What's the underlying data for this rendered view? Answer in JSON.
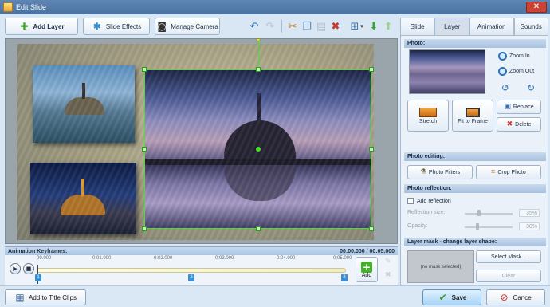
{
  "window": {
    "title": "Edit Slide",
    "close_glyph": "✕"
  },
  "toolbar": {
    "add_layer": "Add Layer",
    "slide_effects": "Slide Effects",
    "manage_camera": "Manage Camera",
    "icons": [
      "undo-icon",
      "redo-icon",
      "cut-icon",
      "copy-icon",
      "paste-icon",
      "delete-icon",
      "align-icon",
      "move-down-icon",
      "move-up-icon"
    ]
  },
  "keyframes": {
    "header": "Animation Keyframes:",
    "time": "00:00.000 / 00:05.000",
    "ticks": [
      "00.000",
      "0:01.000",
      "0:02.000",
      "0:03.000",
      "0:04.000",
      "0:05.000"
    ],
    "markers": [
      "1",
      "2",
      "3"
    ],
    "marker_positions": [
      0,
      0.5,
      1
    ],
    "add_label": "Add"
  },
  "bottom": {
    "add_to_title_clips": "Add to Title Clips",
    "save": "Save",
    "cancel": "Cancel"
  },
  "panel": {
    "tabs": [
      "Slide",
      "Layer",
      "Animation",
      "Sounds"
    ],
    "active_tab": "Layer",
    "photo": {
      "header": "Photo:",
      "zoom_in": "Zoom In",
      "zoom_out": "Zoom Out",
      "stretch": "Stretch",
      "fit_to_frame": "Fit to Frame",
      "replace": "Replace",
      "delete": "Delete"
    },
    "editing": {
      "header": "Photo editing:",
      "photo_filters": "Photo Filters",
      "crop_photo": "Crop Photo"
    },
    "reflection": {
      "header": "Photo reflection:",
      "add_reflection": "Add reflection",
      "size_label": "Reflection size:",
      "size_value": "35%",
      "opacity_label": "Opacity:",
      "opacity_value": "30%"
    },
    "mask": {
      "header": "Layer mask - change layer shape:",
      "no_mask": "(no mask selected)",
      "select_mask": "Select Mask...",
      "clear": "Clear"
    }
  },
  "colors": {
    "accent": "#2a72b8",
    "selection": "#4fdc3a",
    "delete_red": "#d0342c"
  }
}
